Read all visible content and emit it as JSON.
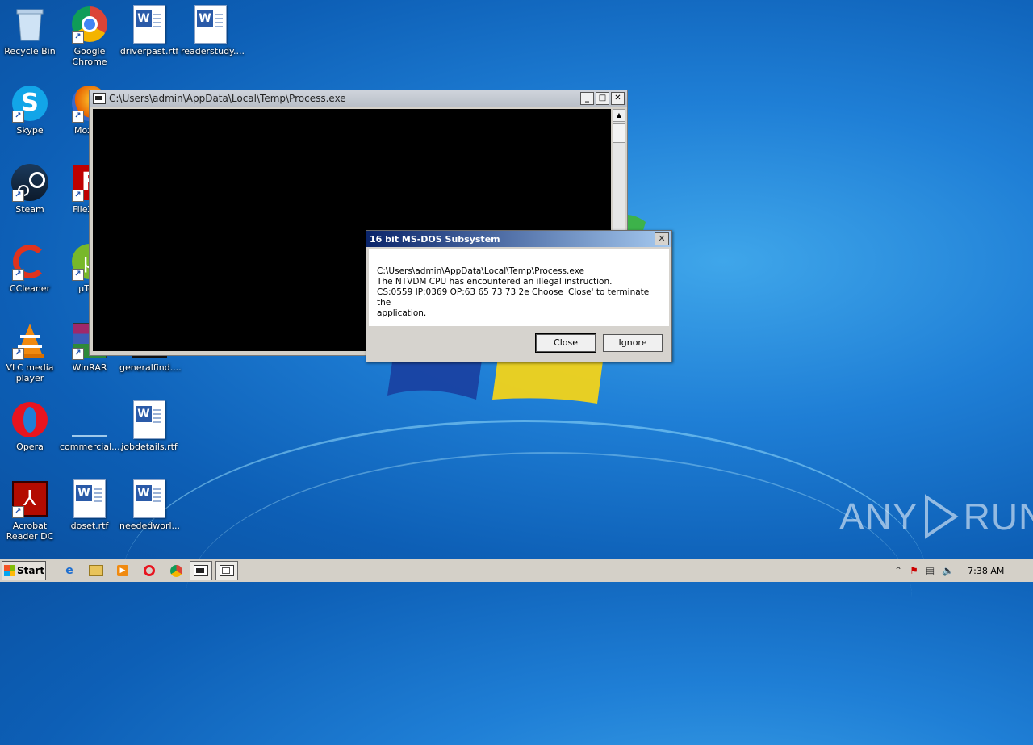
{
  "desktop": {
    "icons": [
      {
        "label": "Recycle Bin",
        "icon": "recycle-bin-icon"
      },
      {
        "label": "Google Chrome",
        "icon": "chrome-icon"
      },
      {
        "label": "driverpast.rtf",
        "icon": "word-document-icon"
      },
      {
        "label": "readerstudy....",
        "icon": "word-document-icon"
      },
      {
        "label": "Skype",
        "icon": "skype-icon"
      },
      {
        "label": "Mozilla",
        "icon": "firefox-icon"
      },
      {
        "label": "Steam",
        "icon": "steam-icon"
      },
      {
        "label": "FileZilla",
        "icon": "filezilla-icon"
      },
      {
        "label": "CCleaner",
        "icon": "ccleaner-icon"
      },
      {
        "label": "µTorr",
        "icon": "utorrent-icon"
      },
      {
        "label": "VLC media player",
        "icon": "vlc-icon"
      },
      {
        "label": "WinRAR",
        "icon": "winrar-icon"
      },
      {
        "label": "generalfind....",
        "icon": "file-icon"
      },
      {
        "label": "Opera",
        "icon": "opera-icon"
      },
      {
        "label": "commercial....",
        "icon": "file-icon"
      },
      {
        "label": "jobdetails.rtf",
        "icon": "word-document-icon"
      },
      {
        "label": "Acrobat Reader DC",
        "icon": "acrobat-icon"
      },
      {
        "label": "doset.rtf",
        "icon": "word-document-icon"
      },
      {
        "label": "neededworl...",
        "icon": "word-document-icon"
      }
    ]
  },
  "console_window": {
    "title": "C:\\Users\\admin\\AppData\\Local\\Temp\\Process.exe"
  },
  "dialog": {
    "title": "16 bit MS-DOS Subsystem",
    "message_lines": [
      "C:\\Users\\admin\\AppData\\Local\\Temp\\Process.exe",
      "The NTVDM CPU has encountered an illegal instruction.",
      "CS:0559 IP:0369 OP:63 65 73 73 2e Choose 'Close' to terminate the",
      "application."
    ],
    "close_label": "Close",
    "ignore_label": "Ignore"
  },
  "taskbar": {
    "start_label": "Start",
    "clock": "7:38 AM"
  },
  "watermark": {
    "left": "ANY",
    "right": "RUN"
  },
  "colors": {
    "dialog_title_start": "#0a246a",
    "dialog_title_end": "#a6caf0"
  }
}
